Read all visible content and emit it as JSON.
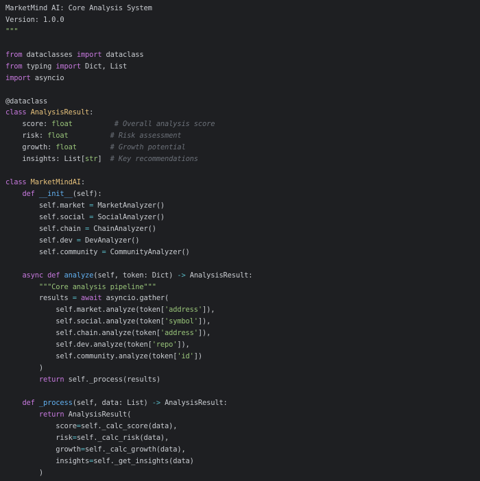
{
  "colors": {
    "background": "#1e1f22",
    "plain": "#c9ccd1",
    "keyword": "#c678dd",
    "class_name": "#e5c07b",
    "function": "#61afef",
    "type": "#98c379",
    "string": "#98c379",
    "comment": "#6b7078",
    "operator": "#56b6c2"
  },
  "code_lines": [
    [
      {
        "t": "plain",
        "v": "MarketMind AI: Core Analysis System"
      }
    ],
    [
      {
        "t": "plain",
        "v": "Version: 1.0.0"
      }
    ],
    [
      {
        "t": "str",
        "v": "\"\"\""
      }
    ],
    [],
    [
      {
        "t": "kw",
        "v": "from"
      },
      {
        "t": "plain",
        "v": " dataclasses "
      },
      {
        "t": "kw",
        "v": "import"
      },
      {
        "t": "plain",
        "v": " dataclass"
      }
    ],
    [
      {
        "t": "kw",
        "v": "from"
      },
      {
        "t": "plain",
        "v": " typing "
      },
      {
        "t": "kw",
        "v": "import"
      },
      {
        "t": "plain",
        "v": " Dict, List"
      }
    ],
    [
      {
        "t": "kw",
        "v": "import"
      },
      {
        "t": "plain",
        "v": " asyncio"
      }
    ],
    [],
    [
      {
        "t": "dec",
        "v": "@dataclass"
      }
    ],
    [
      {
        "t": "kw",
        "v": "class"
      },
      {
        "t": "plain",
        "v": " "
      },
      {
        "t": "cls",
        "v": "AnalysisResult"
      },
      {
        "t": "plain",
        "v": ":"
      }
    ],
    [
      {
        "t": "plain",
        "v": "    score: "
      },
      {
        "t": "type",
        "v": "float"
      },
      {
        "t": "plain",
        "v": "          "
      },
      {
        "t": "cmt",
        "v": "# Overall analysis score"
      }
    ],
    [
      {
        "t": "plain",
        "v": "    risk: "
      },
      {
        "t": "type",
        "v": "float"
      },
      {
        "t": "plain",
        "v": "          "
      },
      {
        "t": "cmt",
        "v": "# Risk assessment"
      }
    ],
    [
      {
        "t": "plain",
        "v": "    growth: "
      },
      {
        "t": "type",
        "v": "float"
      },
      {
        "t": "plain",
        "v": "        "
      },
      {
        "t": "cmt",
        "v": "# Growth potential"
      }
    ],
    [
      {
        "t": "plain",
        "v": "    insights: List["
      },
      {
        "t": "type",
        "v": "str"
      },
      {
        "t": "plain",
        "v": "]  "
      },
      {
        "t": "cmt",
        "v": "# Key recommendations"
      }
    ],
    [],
    [
      {
        "t": "kw",
        "v": "class"
      },
      {
        "t": "plain",
        "v": " "
      },
      {
        "t": "cls",
        "v": "MarketMindAI"
      },
      {
        "t": "plain",
        "v": ":"
      }
    ],
    [
      {
        "t": "plain",
        "v": "    "
      },
      {
        "t": "kw",
        "v": "def"
      },
      {
        "t": "plain",
        "v": " "
      },
      {
        "t": "fn",
        "v": "__init__"
      },
      {
        "t": "plain",
        "v": "(self):"
      }
    ],
    [
      {
        "t": "plain",
        "v": "        self.market "
      },
      {
        "t": "op",
        "v": "="
      },
      {
        "t": "plain",
        "v": " MarketAnalyzer()"
      }
    ],
    [
      {
        "t": "plain",
        "v": "        self.social "
      },
      {
        "t": "op",
        "v": "="
      },
      {
        "t": "plain",
        "v": " SocialAnalyzer()"
      }
    ],
    [
      {
        "t": "plain",
        "v": "        self.chain "
      },
      {
        "t": "op",
        "v": "="
      },
      {
        "t": "plain",
        "v": " ChainAnalyzer()"
      }
    ],
    [
      {
        "t": "plain",
        "v": "        self.dev "
      },
      {
        "t": "op",
        "v": "="
      },
      {
        "t": "plain",
        "v": " DevAnalyzer()"
      }
    ],
    [
      {
        "t": "plain",
        "v": "        self.community "
      },
      {
        "t": "op",
        "v": "="
      },
      {
        "t": "plain",
        "v": " CommunityAnalyzer()"
      }
    ],
    [],
    [
      {
        "t": "plain",
        "v": "    "
      },
      {
        "t": "kw",
        "v": "async"
      },
      {
        "t": "plain",
        "v": " "
      },
      {
        "t": "kw",
        "v": "def"
      },
      {
        "t": "plain",
        "v": " "
      },
      {
        "t": "fn",
        "v": "analyze"
      },
      {
        "t": "plain",
        "v": "(self, token: Dict) "
      },
      {
        "t": "op",
        "v": "->"
      },
      {
        "t": "plain",
        "v": " AnalysisResult:"
      }
    ],
    [
      {
        "t": "plain",
        "v": "        "
      },
      {
        "t": "str",
        "v": "\"\"\"Core analysis pipeline\"\"\""
      }
    ],
    [
      {
        "t": "plain",
        "v": "        results "
      },
      {
        "t": "op",
        "v": "="
      },
      {
        "t": "plain",
        "v": " "
      },
      {
        "t": "kw",
        "v": "await"
      },
      {
        "t": "plain",
        "v": " asyncio.gather("
      }
    ],
    [
      {
        "t": "plain",
        "v": "            self.market.analyze(token["
      },
      {
        "t": "str",
        "v": "'address'"
      },
      {
        "t": "plain",
        "v": "]),"
      }
    ],
    [
      {
        "t": "plain",
        "v": "            self.social.analyze(token["
      },
      {
        "t": "str",
        "v": "'symbol'"
      },
      {
        "t": "plain",
        "v": "]),"
      }
    ],
    [
      {
        "t": "plain",
        "v": "            self.chain.analyze(token["
      },
      {
        "t": "str",
        "v": "'address'"
      },
      {
        "t": "plain",
        "v": "]),"
      }
    ],
    [
      {
        "t": "plain",
        "v": "            self.dev.analyze(token["
      },
      {
        "t": "str",
        "v": "'repo'"
      },
      {
        "t": "plain",
        "v": "]),"
      }
    ],
    [
      {
        "t": "plain",
        "v": "            self.community.analyze(token["
      },
      {
        "t": "str",
        "v": "'id'"
      },
      {
        "t": "plain",
        "v": "])"
      }
    ],
    [
      {
        "t": "plain",
        "v": "        )"
      }
    ],
    [
      {
        "t": "plain",
        "v": "        "
      },
      {
        "t": "kw",
        "v": "return"
      },
      {
        "t": "plain",
        "v": " self._process(results)"
      }
    ],
    [],
    [
      {
        "t": "plain",
        "v": "    "
      },
      {
        "t": "kw",
        "v": "def"
      },
      {
        "t": "plain",
        "v": " "
      },
      {
        "t": "fn",
        "v": "_process"
      },
      {
        "t": "plain",
        "v": "(self, data: List) "
      },
      {
        "t": "op",
        "v": "->"
      },
      {
        "t": "plain",
        "v": " AnalysisResult:"
      }
    ],
    [
      {
        "t": "plain",
        "v": "        "
      },
      {
        "t": "kw",
        "v": "return"
      },
      {
        "t": "plain",
        "v": " AnalysisResult("
      }
    ],
    [
      {
        "t": "plain",
        "v": "            score"
      },
      {
        "t": "op",
        "v": "="
      },
      {
        "t": "plain",
        "v": "self._calc_score(data),"
      }
    ],
    [
      {
        "t": "plain",
        "v": "            risk"
      },
      {
        "t": "op",
        "v": "="
      },
      {
        "t": "plain",
        "v": "self._calc_risk(data),"
      }
    ],
    [
      {
        "t": "plain",
        "v": "            growth"
      },
      {
        "t": "op",
        "v": "="
      },
      {
        "t": "plain",
        "v": "self._calc_growth(data),"
      }
    ],
    [
      {
        "t": "plain",
        "v": "            insights"
      },
      {
        "t": "op",
        "v": "="
      },
      {
        "t": "plain",
        "v": "self._get_insights(data)"
      }
    ],
    [
      {
        "t": "plain",
        "v": "        )"
      }
    ]
  ]
}
